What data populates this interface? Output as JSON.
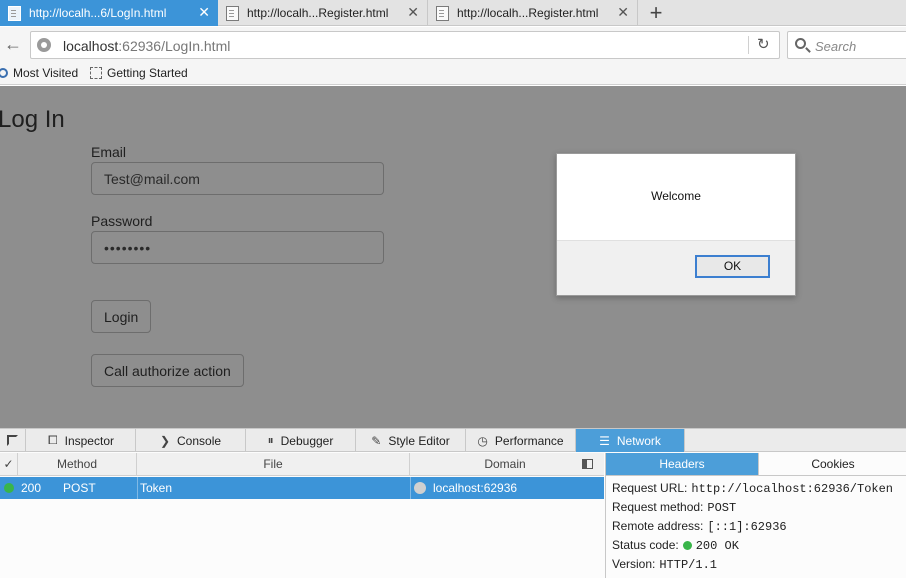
{
  "tabs": [
    {
      "label": "http://localh...6/LogIn.html",
      "active": true
    },
    {
      "label": "http://localh...Register.html",
      "active": false
    },
    {
      "label": "http://localh...Register.html",
      "active": false
    }
  ],
  "tab_close_glyph": "✕",
  "newtab_glyph": "+",
  "nav": {
    "url_host": "localhost",
    "url_rest": ":62936/LogIn.html",
    "search_placeholder": "Search"
  },
  "bookmarks": {
    "most_visited": "Most Visited",
    "getting_started": "Getting Started"
  },
  "page": {
    "title": "Log In",
    "email_label": "Email",
    "email_value": "Test@mail.com",
    "password_label": "Password",
    "password_value": "••••••••",
    "login_button": "Login",
    "authorize_button": "Call authorize action"
  },
  "modal": {
    "message": "Welcome",
    "ok_label": "OK"
  },
  "devtools": {
    "tabs": [
      "Inspector",
      "Console",
      "Debugger",
      "Style Editor",
      "Performance",
      "Network"
    ],
    "active_tab": "Network",
    "columns": {
      "check": "✓",
      "method": "Method",
      "file": "File",
      "domain": "Domain"
    },
    "requests": [
      {
        "status": "200",
        "method": "POST",
        "file": "Token",
        "domain": "localhost:62936",
        "status_color": "#39b54a"
      }
    ],
    "side_tabs": [
      "Headers",
      "Cookies"
    ],
    "headers": {
      "request_url_label": "Request URL:",
      "request_url": "http://localhost:62936/Token",
      "request_method_label": "Request method:",
      "request_method": "POST",
      "remote_address_label": "Remote address:",
      "remote_address": "[::1]:62936",
      "status_code_label": "Status code:",
      "status_code": "200 OK",
      "version_label": "Version:",
      "version": "HTTP/1.1"
    }
  },
  "colors": {
    "accent": "#3c94d8",
    "status_ok": "#39b54a",
    "overlay": "#8e8e8e"
  }
}
